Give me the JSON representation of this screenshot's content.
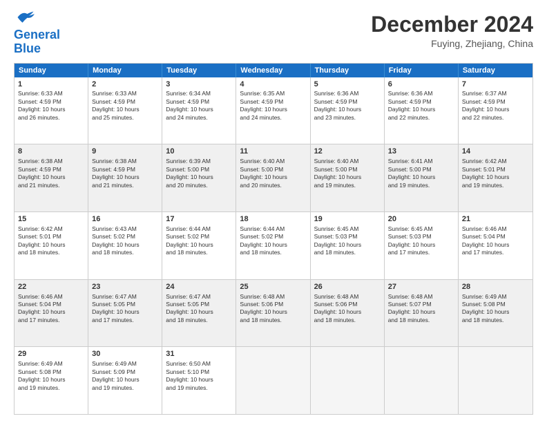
{
  "header": {
    "logo_line1": "General",
    "logo_line2": "Blue",
    "month": "December 2024",
    "location": "Fuying, Zhejiang, China"
  },
  "weekdays": [
    "Sunday",
    "Monday",
    "Tuesday",
    "Wednesday",
    "Thursday",
    "Friday",
    "Saturday"
  ],
  "rows": [
    [
      {
        "day": "1",
        "lines": [
          "Sunrise: 6:33 AM",
          "Sunset: 4:59 PM",
          "Daylight: 10 hours",
          "and 26 minutes."
        ],
        "shade": false
      },
      {
        "day": "2",
        "lines": [
          "Sunrise: 6:33 AM",
          "Sunset: 4:59 PM",
          "Daylight: 10 hours",
          "and 25 minutes."
        ],
        "shade": false
      },
      {
        "day": "3",
        "lines": [
          "Sunrise: 6:34 AM",
          "Sunset: 4:59 PM",
          "Daylight: 10 hours",
          "and 24 minutes."
        ],
        "shade": false
      },
      {
        "day": "4",
        "lines": [
          "Sunrise: 6:35 AM",
          "Sunset: 4:59 PM",
          "Daylight: 10 hours",
          "and 24 minutes."
        ],
        "shade": false
      },
      {
        "day": "5",
        "lines": [
          "Sunrise: 6:36 AM",
          "Sunset: 4:59 PM",
          "Daylight: 10 hours",
          "and 23 minutes."
        ],
        "shade": false
      },
      {
        "day": "6",
        "lines": [
          "Sunrise: 6:36 AM",
          "Sunset: 4:59 PM",
          "Daylight: 10 hours",
          "and 22 minutes."
        ],
        "shade": false
      },
      {
        "day": "7",
        "lines": [
          "Sunrise: 6:37 AM",
          "Sunset: 4:59 PM",
          "Daylight: 10 hours",
          "and 22 minutes."
        ],
        "shade": false
      }
    ],
    [
      {
        "day": "8",
        "lines": [
          "Sunrise: 6:38 AM",
          "Sunset: 4:59 PM",
          "Daylight: 10 hours",
          "and 21 minutes."
        ],
        "shade": true
      },
      {
        "day": "9",
        "lines": [
          "Sunrise: 6:38 AM",
          "Sunset: 4:59 PM",
          "Daylight: 10 hours",
          "and 21 minutes."
        ],
        "shade": true
      },
      {
        "day": "10",
        "lines": [
          "Sunrise: 6:39 AM",
          "Sunset: 5:00 PM",
          "Daylight: 10 hours",
          "and 20 minutes."
        ],
        "shade": true
      },
      {
        "day": "11",
        "lines": [
          "Sunrise: 6:40 AM",
          "Sunset: 5:00 PM",
          "Daylight: 10 hours",
          "and 20 minutes."
        ],
        "shade": true
      },
      {
        "day": "12",
        "lines": [
          "Sunrise: 6:40 AM",
          "Sunset: 5:00 PM",
          "Daylight: 10 hours",
          "and 19 minutes."
        ],
        "shade": true
      },
      {
        "day": "13",
        "lines": [
          "Sunrise: 6:41 AM",
          "Sunset: 5:00 PM",
          "Daylight: 10 hours",
          "and 19 minutes."
        ],
        "shade": true
      },
      {
        "day": "14",
        "lines": [
          "Sunrise: 6:42 AM",
          "Sunset: 5:01 PM",
          "Daylight: 10 hours",
          "and 19 minutes."
        ],
        "shade": true
      }
    ],
    [
      {
        "day": "15",
        "lines": [
          "Sunrise: 6:42 AM",
          "Sunset: 5:01 PM",
          "Daylight: 10 hours",
          "and 18 minutes."
        ],
        "shade": false
      },
      {
        "day": "16",
        "lines": [
          "Sunrise: 6:43 AM",
          "Sunset: 5:02 PM",
          "Daylight: 10 hours",
          "and 18 minutes."
        ],
        "shade": false
      },
      {
        "day": "17",
        "lines": [
          "Sunrise: 6:44 AM",
          "Sunset: 5:02 PM",
          "Daylight: 10 hours",
          "and 18 minutes."
        ],
        "shade": false
      },
      {
        "day": "18",
        "lines": [
          "Sunrise: 6:44 AM",
          "Sunset: 5:02 PM",
          "Daylight: 10 hours",
          "and 18 minutes."
        ],
        "shade": false
      },
      {
        "day": "19",
        "lines": [
          "Sunrise: 6:45 AM",
          "Sunset: 5:03 PM",
          "Daylight: 10 hours",
          "and 18 minutes."
        ],
        "shade": false
      },
      {
        "day": "20",
        "lines": [
          "Sunrise: 6:45 AM",
          "Sunset: 5:03 PM",
          "Daylight: 10 hours",
          "and 17 minutes."
        ],
        "shade": false
      },
      {
        "day": "21",
        "lines": [
          "Sunrise: 6:46 AM",
          "Sunset: 5:04 PM",
          "Daylight: 10 hours",
          "and 17 minutes."
        ],
        "shade": false
      }
    ],
    [
      {
        "day": "22",
        "lines": [
          "Sunrise: 6:46 AM",
          "Sunset: 5:04 PM",
          "Daylight: 10 hours",
          "and 17 minutes."
        ],
        "shade": true
      },
      {
        "day": "23",
        "lines": [
          "Sunrise: 6:47 AM",
          "Sunset: 5:05 PM",
          "Daylight: 10 hours",
          "and 17 minutes."
        ],
        "shade": true
      },
      {
        "day": "24",
        "lines": [
          "Sunrise: 6:47 AM",
          "Sunset: 5:05 PM",
          "Daylight: 10 hours",
          "and 18 minutes."
        ],
        "shade": true
      },
      {
        "day": "25",
        "lines": [
          "Sunrise: 6:48 AM",
          "Sunset: 5:06 PM",
          "Daylight: 10 hours",
          "and 18 minutes."
        ],
        "shade": true
      },
      {
        "day": "26",
        "lines": [
          "Sunrise: 6:48 AM",
          "Sunset: 5:06 PM",
          "Daylight: 10 hours",
          "and 18 minutes."
        ],
        "shade": true
      },
      {
        "day": "27",
        "lines": [
          "Sunrise: 6:48 AM",
          "Sunset: 5:07 PM",
          "Daylight: 10 hours",
          "and 18 minutes."
        ],
        "shade": true
      },
      {
        "day": "28",
        "lines": [
          "Sunrise: 6:49 AM",
          "Sunset: 5:08 PM",
          "Daylight: 10 hours",
          "and 18 minutes."
        ],
        "shade": true
      }
    ],
    [
      {
        "day": "29",
        "lines": [
          "Sunrise: 6:49 AM",
          "Sunset: 5:08 PM",
          "Daylight: 10 hours",
          "and 19 minutes."
        ],
        "shade": false
      },
      {
        "day": "30",
        "lines": [
          "Sunrise: 6:49 AM",
          "Sunset: 5:09 PM",
          "Daylight: 10 hours",
          "and 19 minutes."
        ],
        "shade": false
      },
      {
        "day": "31",
        "lines": [
          "Sunrise: 6:50 AM",
          "Sunset: 5:10 PM",
          "Daylight: 10 hours",
          "and 19 minutes."
        ],
        "shade": false
      },
      {
        "day": "",
        "lines": [],
        "shade": true,
        "empty": true
      },
      {
        "day": "",
        "lines": [],
        "shade": true,
        "empty": true
      },
      {
        "day": "",
        "lines": [],
        "shade": true,
        "empty": true
      },
      {
        "day": "",
        "lines": [],
        "shade": true,
        "empty": true
      }
    ]
  ]
}
